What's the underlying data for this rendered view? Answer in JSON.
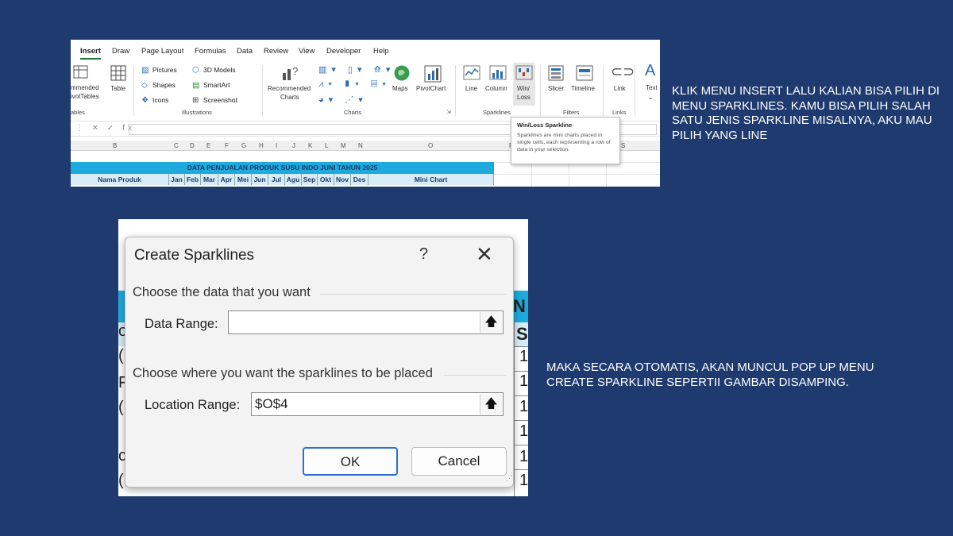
{
  "excel": {
    "tabs": [
      "Insert",
      "Draw",
      "Page Layout",
      "Formulas",
      "Data",
      "Review",
      "View",
      "Developer",
      "Help"
    ],
    "active_tab": "Insert",
    "ribbon": {
      "pivot_partial_1": "mmended",
      "pivot_partial_2": "ivotTables",
      "tables_group_partial": "ables",
      "table": "Table",
      "pictures": "Pictures",
      "shapes": "Shapes",
      "icons": "Icons",
      "models_3d": "3D Models",
      "smartart": "SmartArt",
      "screenshot": "Screenshot",
      "illustrations_group": "Illustrations",
      "recommended_charts_1": "Recommended",
      "recommended_charts_2": "Charts",
      "maps": "Maps",
      "pivotchart": "PivotChart",
      "charts_group": "Charts",
      "line": "Line",
      "column": "Column",
      "winloss_1": "Win/",
      "winloss_2": "Loss",
      "sparklines_group": "Sparklines",
      "slicer": "Slicer",
      "timeline": "Timeline",
      "filters_group": "Filters",
      "link": "Link",
      "links_group": "Links",
      "text": "Text"
    },
    "formula_icons": "⋮ ✕ ✓ fx",
    "columns": [
      "B",
      "C",
      "D",
      "E",
      "F",
      "G",
      "H",
      "I",
      "J",
      "K",
      "L",
      "M",
      "N",
      "O",
      "P",
      "S"
    ],
    "sheet_title": "DATA PENJUALAN PRODUK SUSU INDO JUNI TAHUN 2025",
    "header_row": {
      "name": "Nama Produk",
      "months": [
        "Jan",
        "Feb",
        "Mar",
        "Apr",
        "Mei",
        "Jun",
        "Jul",
        "Agu",
        "Sep",
        "Okt",
        "Nov",
        "Des"
      ],
      "mini": "Mini Chart"
    },
    "tooltip": {
      "title": "Win/Loss Sparkline",
      "body": "Sparklines are mini charts placed in single cells, each representing a row of data in your selection."
    }
  },
  "dialog": {
    "title": "Create Sparklines",
    "help": "?",
    "close": "✕",
    "section1": "Choose the data that you want",
    "data_range_label": "Data Range:",
    "data_range_value": "",
    "section2": "Choose where you want the sparklines to be placed",
    "location_range_label": "Location Range:",
    "location_range_value": "$O$4",
    "ok": "OK",
    "cancel": "Cancel",
    "background": {
      "header_partial": "N",
      "subheader_partial": "S",
      "row_values": [
        "1",
        "1",
        "1",
        "1",
        "1",
        "1"
      ],
      "left_partials": [
        "o",
        "(",
        "F",
        "(",
        "c",
        "("
      ]
    }
  },
  "notes": {
    "top": "KLIK MENU INSERT  LALU KALIAN BISA PILIH DI MENU SPARKLINES. KAMU BISA PILIH SALAH SATU JENIS SPARKLINE MISALNYA, AKU MAU PILIH YANG LINE",
    "bottom": "MAKA SECARA OTOMATIS, AKAN MUNCUL POP UP MENU CREATE SPARKLINE SEPERTII GAMBAR DISAMPING."
  }
}
